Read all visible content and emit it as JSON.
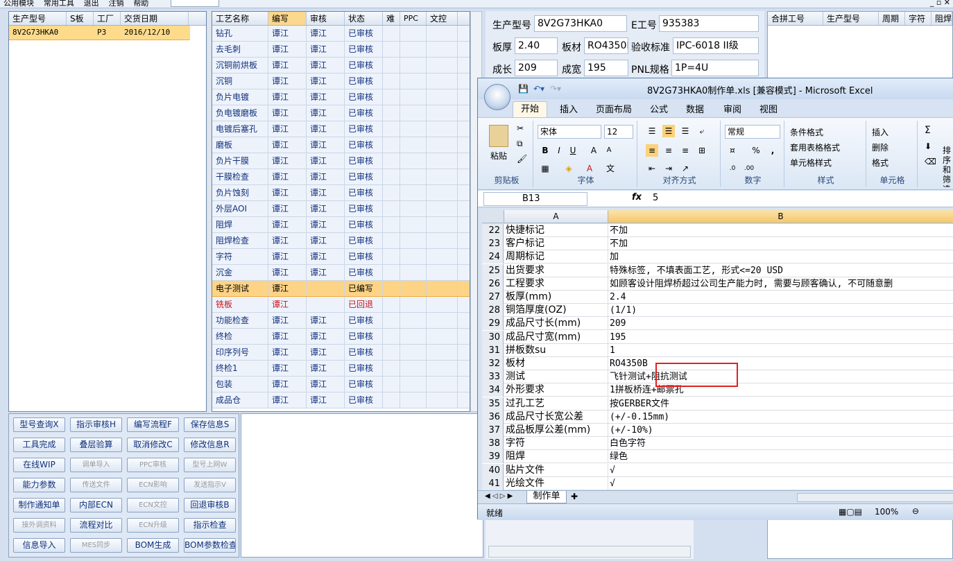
{
  "menubar": {
    "items": [
      "公用模块",
      "常用工具",
      "退出",
      "注销",
      "帮助"
    ]
  },
  "orders": {
    "headers": [
      "生产型号",
      "S板",
      "工厂",
      "交货日期"
    ],
    "rows": [
      {
        "model": "8V2G73HKA0",
        "s": "",
        "factory": "P3",
        "date": "2016/12/10"
      }
    ]
  },
  "process": {
    "headers": [
      "工艺名称",
      "编写",
      "审核",
      "状态",
      "难",
      "PPC",
      "文控"
    ],
    "rows": [
      {
        "name": "钻孔",
        "writer": "谭江",
        "auditor": "谭江",
        "status": "已审核"
      },
      {
        "name": "去毛刺",
        "writer": "谭江",
        "auditor": "谭江",
        "status": "已审核"
      },
      {
        "name": "沉铜前烘板",
        "writer": "谭江",
        "auditor": "谭江",
        "status": "已审核"
      },
      {
        "name": "沉铜",
        "writer": "谭江",
        "auditor": "谭江",
        "status": "已审核"
      },
      {
        "name": "负片电镀",
        "writer": "谭江",
        "auditor": "谭江",
        "status": "已审核"
      },
      {
        "name": "负电镀磨板",
        "writer": "谭江",
        "auditor": "谭江",
        "status": "已审核"
      },
      {
        "name": "电镀后塞孔",
        "writer": "谭江",
        "auditor": "谭江",
        "status": "已审核"
      },
      {
        "name": "磨板",
        "writer": "谭江",
        "auditor": "谭江",
        "status": "已审核"
      },
      {
        "name": "负片干膜",
        "writer": "谭江",
        "auditor": "谭江",
        "status": "已审核"
      },
      {
        "name": "干膜检查",
        "writer": "谭江",
        "auditor": "谭江",
        "status": "已审核"
      },
      {
        "name": "负片蚀刻",
        "writer": "谭江",
        "auditor": "谭江",
        "status": "已审核"
      },
      {
        "name": "外层AOI",
        "writer": "谭江",
        "auditor": "谭江",
        "status": "已审核"
      },
      {
        "name": "阻焊",
        "writer": "谭江",
        "auditor": "谭江",
        "status": "已审核"
      },
      {
        "name": "阻焊检查",
        "writer": "谭江",
        "auditor": "谭江",
        "status": "已审核"
      },
      {
        "name": "字符",
        "writer": "谭江",
        "auditor": "谭江",
        "status": "已审核"
      },
      {
        "name": "沉金",
        "writer": "谭江",
        "auditor": "谭江",
        "status": "已审核"
      },
      {
        "name": "电子测试",
        "writer": "谭江",
        "auditor": "",
        "status": "已编写"
      },
      {
        "name": "铣板",
        "writer": "谭江",
        "auditor": "",
        "status": "已回退"
      },
      {
        "name": "功能检查",
        "writer": "谭江",
        "auditor": "谭江",
        "status": "已审核"
      },
      {
        "name": "终检",
        "writer": "谭江",
        "auditor": "谭江",
        "status": "已审核"
      },
      {
        "name": "印序列号",
        "writer": "谭江",
        "auditor": "谭江",
        "status": "已审核"
      },
      {
        "name": "终检1",
        "writer": "谭江",
        "auditor": "谭江",
        "status": "已审核"
      },
      {
        "name": "包装",
        "writer": "谭江",
        "auditor": "谭江",
        "status": "已审核"
      },
      {
        "name": "成品仓",
        "writer": "谭江",
        "auditor": "谭江",
        "status": "已审核"
      }
    ]
  },
  "buttons": [
    [
      "型号查询X",
      "指示审核H",
      "编写流程F",
      "保存信息S"
    ],
    [
      "工具完成",
      "叠层验算",
      "取消修改C",
      "修改信息R"
    ],
    [
      "在线WIP",
      "调单导入",
      "PPC审核",
      "型号上网W"
    ],
    [
      "能力参数",
      "传送文件",
      "ECN影响",
      "发送指示V"
    ],
    [
      "制作通知单",
      "内部ECN",
      "ECN文控",
      "回退审核B"
    ],
    [
      "接外调资料",
      "流程对比",
      "ECN升级",
      "指示检查"
    ],
    [
      "信息导入",
      "MES同步",
      "BOM生成",
      "BOM参数检查"
    ]
  ],
  "info": {
    "model_label": "生产型号",
    "model": "8V2G73HKA0",
    "eng_label": "E工号",
    "eng": "935383",
    "thick_label": "板厚",
    "thick": "2.40",
    "material_label": "板材",
    "material": "RO4350B",
    "std_label": "验收标准",
    "std": "IPC-6018 II级",
    "length_label": "成长",
    "length": "209",
    "width_label": "成宽",
    "width": "195",
    "pnl_label": "PNL规格",
    "pnl": "1P=4U"
  },
  "merge": {
    "headers": [
      "合拼工号",
      "生产型号",
      "周期",
      "字符",
      "阻焊"
    ]
  },
  "excel": {
    "title": "8V2G73HKA0制作单.xls [兼容模式] - Microsoft Excel",
    "tabs": [
      "开始",
      "插入",
      "页面布局",
      "公式",
      "数据",
      "审阅",
      "视图"
    ],
    "ribbon": {
      "paste": "粘贴",
      "clipboard": "剪贴板",
      "font_name": "宋体",
      "font_size": "12",
      "font_group": "字体",
      "align_group": "对齐方式",
      "number_format": "常规",
      "number_group": "数字",
      "cond_format": "条件格式",
      "table_format": "套用表格格式",
      "cell_style": "单元格样式",
      "style_group": "样式",
      "insert": "插入",
      "delete": "删除",
      "format": "格式",
      "cells_group": "单元格",
      "sort": "排序和筛选"
    },
    "namebox": "B13",
    "formula": "5",
    "columns": [
      "A",
      "B"
    ],
    "rows": [
      {
        "n": "22",
        "a": "快捷标记",
        "b": "不加"
      },
      {
        "n": "23",
        "a": "客户标记",
        "b": "不加"
      },
      {
        "n": "24",
        "a": "周期标记",
        "b": "加"
      },
      {
        "n": "25",
        "a": "出货要求",
        "b": "特殊标签, 不填表面工艺, 形式<=20 USD"
      },
      {
        "n": "26",
        "a": "工程要求",
        "b": "如顾客设计阻焊桥超过公司生产能力时, 需要与顾客确认, 不可随意删"
      },
      {
        "n": "27",
        "a": "板厚(mm)",
        "b": "2.4"
      },
      {
        "n": "28",
        "a": "铜箔厚度(OZ)",
        "b": "(1/1)"
      },
      {
        "n": "29",
        "a": "成品尺寸长(mm)",
        "b": "209"
      },
      {
        "n": "30",
        "a": "成品尺寸宽(mm)",
        "b": "195"
      },
      {
        "n": "31",
        "a": "拼板数su",
        "b": "1"
      },
      {
        "n": "32",
        "a": "板材",
        "b": "RO4350B"
      },
      {
        "n": "33",
        "a": "测试",
        "b": "飞针测试+阻抗测试"
      },
      {
        "n": "34",
        "a": "外形要求",
        "b": "1拼板桥连+邮票孔"
      },
      {
        "n": "35",
        "a": "过孔工艺",
        "b": "按GERBER文件"
      },
      {
        "n": "36",
        "a": "成品尺寸长宽公差",
        "b": "(+/-0.15mm)"
      },
      {
        "n": "37",
        "a": "成品板厚公差(mm)",
        "b": "(+/-10%)"
      },
      {
        "n": "38",
        "a": "字符",
        "b": "白色字符"
      },
      {
        "n": "39",
        "a": "阻焊",
        "b": "绿色"
      },
      {
        "n": "40",
        "a": "贴片文件",
        "b": "√"
      },
      {
        "n": "41",
        "a": "光绘文件",
        "b": "√"
      }
    ],
    "sheet_tab": "制作单",
    "status": "就绪",
    "zoom": "100%"
  }
}
